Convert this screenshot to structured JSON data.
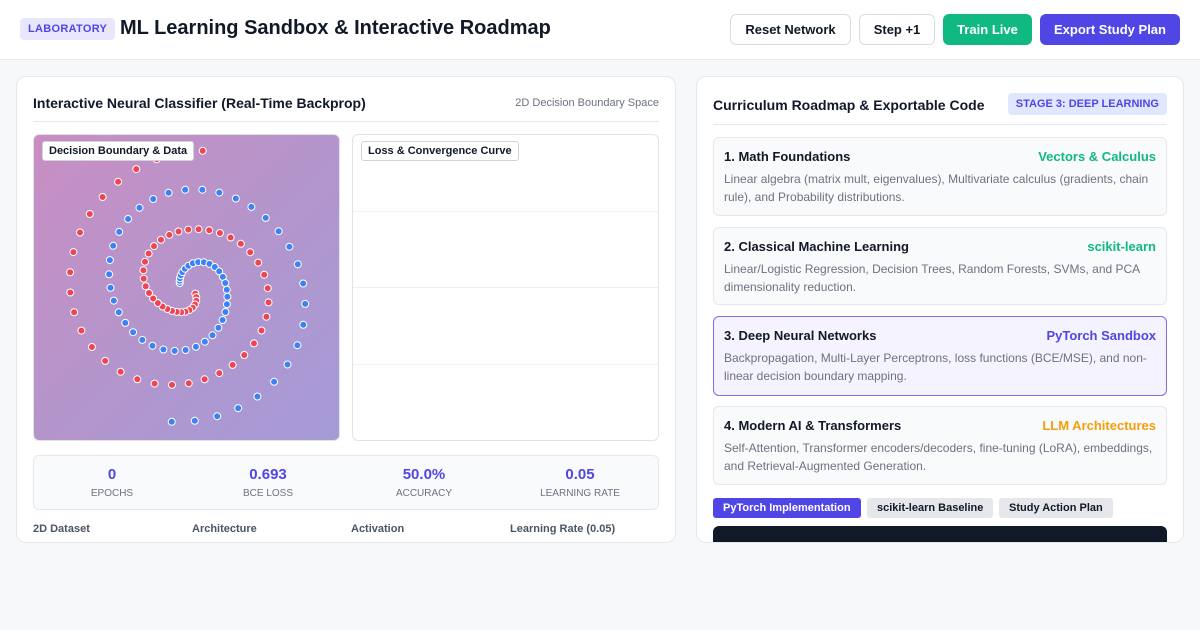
{
  "header": {
    "badge": "LABORATORY",
    "title": "ML Learning Sandbox & Interactive Roadmap",
    "buttons": {
      "reset": "Reset Network",
      "step": "Step +1",
      "train": "Train Live",
      "export": "Export Study Plan"
    }
  },
  "classifier": {
    "title": "Interactive Neural Classifier (Real-Time Backprop)",
    "subtitle": "2D Decision Boundary Space",
    "decision_label": "Decision Boundary & Data",
    "loss_label": "Loss & Convergence Curve",
    "stats": [
      {
        "value": "0",
        "label": "EPOCHS"
      },
      {
        "value": "0.693",
        "label": "BCE LOSS"
      },
      {
        "value": "50.0%",
        "label": "ACCURACY"
      },
      {
        "value": "0.05",
        "label": "LEARNING RATE"
      }
    ],
    "controls": [
      "2D Dataset",
      "Architecture",
      "Activation",
      "Learning Rate (0.05)"
    ]
  },
  "roadmap": {
    "title": "Curriculum Roadmap & Exportable Code",
    "stage_badge": "STAGE 3: DEEP LEARNING",
    "cards": [
      {
        "title": "1. Math Foundations",
        "tag": "Vectors & Calculus",
        "desc": "Linear algebra (matrix mult, eigenvalues), Multivariate calculus (gradients, chain rule), and Probability distributions."
      },
      {
        "title": "2. Classical Machine Learning",
        "tag": "scikit-learn",
        "desc": "Linear/Logistic Regression, Decision Trees, Random Forests, SVMs, and PCA dimensionality reduction."
      },
      {
        "title": "3. Deep Neural Networks",
        "tag": "PyTorch Sandbox",
        "desc": "Backpropagation, Multi-Layer Perceptrons, loss functions (BCE/MSE), and non-linear decision boundary mapping."
      },
      {
        "title": "4. Modern AI & Transformers",
        "tag": "LLM Architectures",
        "desc": "Self-Attention, Transformer encoders/decoders, fine-tuning (LoRA), embeddings, and Retrieval-Augmented Generation."
      }
    ],
    "tabs": [
      "PyTorch Implementation",
      "scikit-learn Baseline",
      "Study Action Plan"
    ]
  },
  "colors": {
    "accent": "#4f46e5",
    "green": "#10b981",
    "amber": "#f59e0b",
    "class_red": "#ef4453",
    "class_blue": "#3b82f6"
  }
}
